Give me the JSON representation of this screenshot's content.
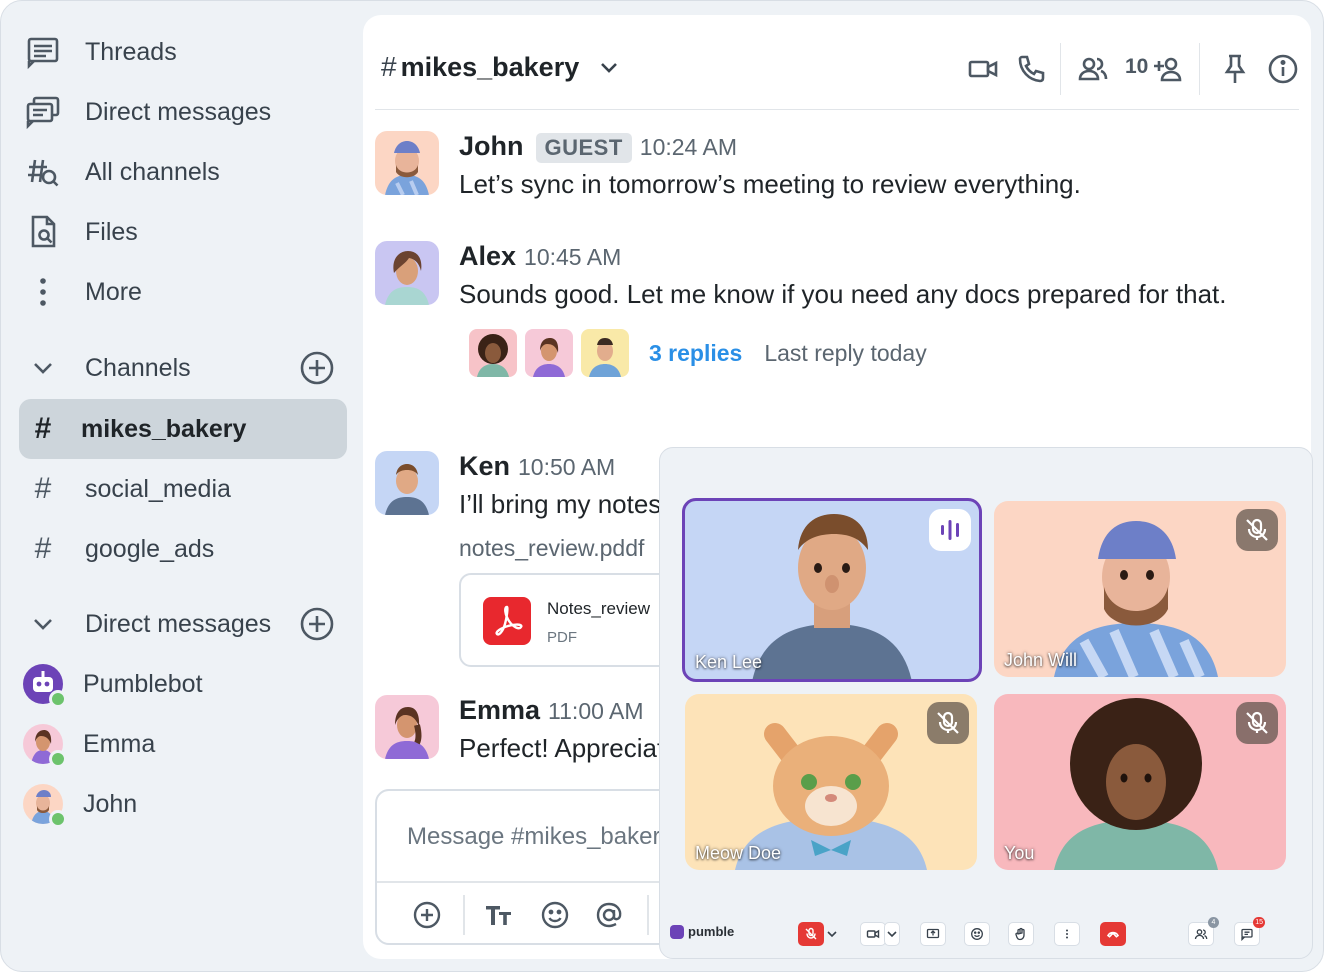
{
  "nav": {
    "items": [
      {
        "label": "Threads",
        "icon": "threads-icon"
      },
      {
        "label": "Direct messages",
        "icon": "direct-messages-icon"
      },
      {
        "label": "All channels",
        "icon": "all-channels-icon"
      },
      {
        "label": "Files",
        "icon": "files-icon"
      },
      {
        "label": "More",
        "icon": "more-icon"
      }
    ]
  },
  "channels_section": {
    "label": "Channels",
    "items": [
      {
        "name": "mikes_bakery",
        "active": true
      },
      {
        "name": "social_media",
        "active": false
      },
      {
        "name": "google_ads",
        "active": false
      }
    ]
  },
  "dm_section": {
    "label": "Direct messages",
    "items": [
      {
        "name": "Pumblebot",
        "status": "online"
      },
      {
        "name": "Emma",
        "status": "online"
      },
      {
        "name": "John",
        "status": "online"
      }
    ]
  },
  "header": {
    "hash": "#",
    "channel": "mikes_bakery",
    "member_count": "10"
  },
  "messages": [
    {
      "author": "John",
      "badge": "GUEST",
      "time": "10:24 AM",
      "text": "Let’s sync in tomorrow’s meeting to review everything."
    },
    {
      "author": "Alex",
      "time": "10:45 AM",
      "text": "Sounds good. Let me know if you need any docs prepared for that.",
      "thread": {
        "replies": "3 replies",
        "meta": "Last reply today"
      }
    },
    {
      "author": "Ken",
      "time": "10:50 AM",
      "text": "I’ll bring my notes",
      "file": {
        "link": "notes_review.pddf",
        "title": "Notes_review",
        "type": "PDF"
      }
    },
    {
      "author": "Emma",
      "time": "11:00 AM",
      "text": "Perfect! Appreciate it."
    }
  ],
  "composer": {
    "placeholder": "Message #mikes_bakery"
  },
  "call": {
    "tiles": [
      {
        "name": "Ken Lee",
        "state": "speaking"
      },
      {
        "name": "John Will",
        "state": "muted"
      },
      {
        "name": "Meow Doe",
        "state": "muted"
      },
      {
        "name": "You",
        "state": "muted"
      }
    ],
    "brand": "pumble",
    "participants_badge": "4",
    "chat_badge": "15"
  },
  "colors": {
    "accent_purple": "#6c43b7",
    "link_blue": "#2a8fe6",
    "online_green": "#6cc36c",
    "end_call_red": "#e53935",
    "pdf_red": "#e8282e"
  }
}
